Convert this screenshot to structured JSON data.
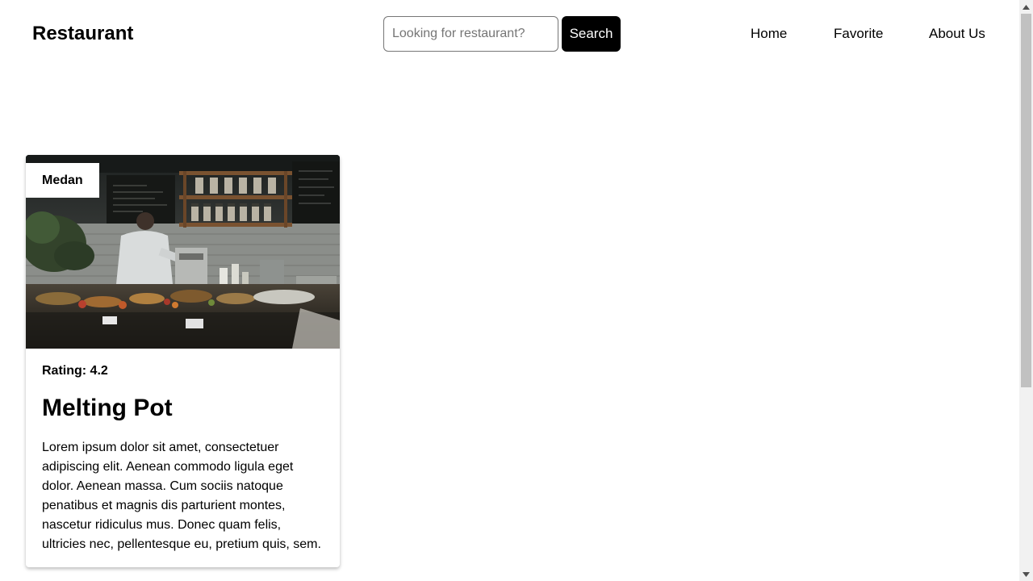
{
  "header": {
    "brand": "Restaurant",
    "search": {
      "placeholder": "Looking for restaurant?",
      "value": "",
      "button_label": "Search"
    },
    "nav": {
      "home": "Home",
      "favorite": "Favorite",
      "about": "About Us"
    }
  },
  "restaurants": [
    {
      "city": "Medan",
      "rating_label": "Rating: ",
      "rating": "4.2",
      "name": "Melting Pot",
      "description": "Lorem ipsum dolor sit amet, consectetuer adipiscing elit. Aenean commodo ligula eget dolor. Aenean massa. Cum sociis natoque penatibus et magnis dis parturient montes, nascetur ridiculus mus. Donec quam felis, ultricies nec, pellentesque eu, pretium quis, sem.",
      "image": "restaurant-counter-photo"
    }
  ],
  "colors": {
    "primary": "#000000",
    "background": "#ffffff",
    "scrollbar_track": "#f1f1f1",
    "scrollbar_thumb": "#c1c1c1"
  },
  "icons": {
    "scroll_up": "triangle-up-icon",
    "scroll_down": "triangle-down-icon"
  }
}
